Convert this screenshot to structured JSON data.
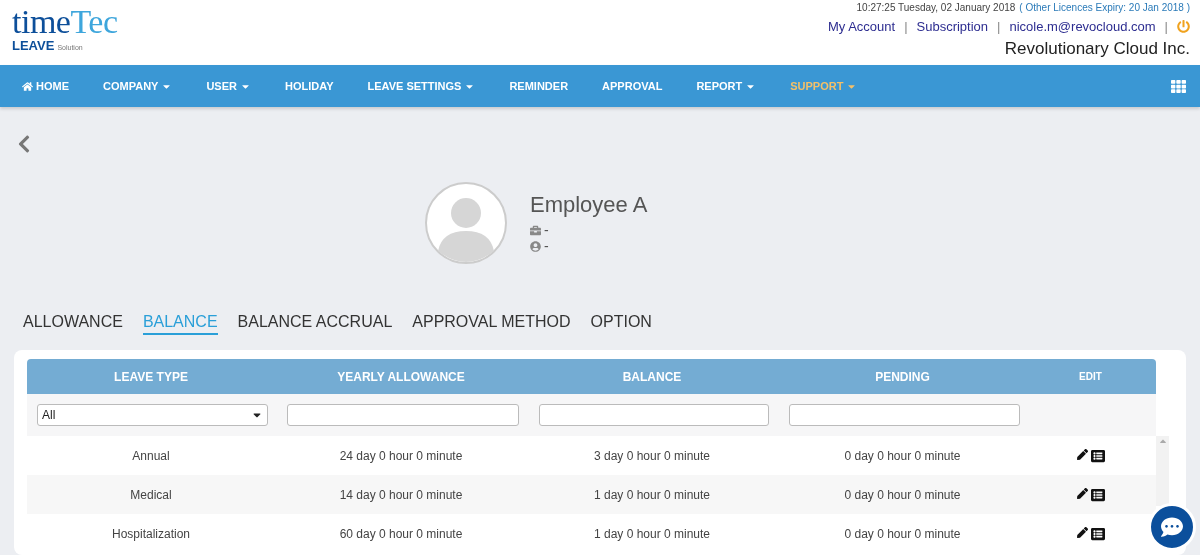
{
  "logo": {
    "word_dark": "time",
    "word_light": "Tec",
    "product": "LEAVE",
    "suffix": "Solution"
  },
  "header": {
    "datetime": "10:27:25 Tuesday, 02 January 2018",
    "licence_note": "( Other Licences Expiry:  20 Jan 2018  )",
    "links": [
      "My Account",
      "Subscription",
      "nicole.m@revocloud.com"
    ],
    "separators": [
      "|",
      "|",
      "|"
    ],
    "company": "Revolutionary Cloud Inc."
  },
  "nav": [
    {
      "label": "HOME",
      "kind": "home",
      "dropdown": false,
      "selected": false
    },
    {
      "label": "COMPANY",
      "kind": "plain",
      "dropdown": true,
      "selected": false
    },
    {
      "label": "USER",
      "kind": "plain",
      "dropdown": true,
      "selected": false
    },
    {
      "label": "HOLIDAY",
      "kind": "plain",
      "dropdown": false,
      "selected": false
    },
    {
      "label": "LEAVE SETTINGS",
      "kind": "plain",
      "dropdown": true,
      "selected": false
    },
    {
      "label": "REMINDER",
      "kind": "plain",
      "dropdown": false,
      "selected": false
    },
    {
      "label": "APPROVAL",
      "kind": "plain",
      "dropdown": false,
      "selected": false
    },
    {
      "label": "REPORT",
      "kind": "plain",
      "dropdown": true,
      "selected": false
    },
    {
      "label": "SUPPORT",
      "kind": "plain",
      "dropdown": true,
      "selected": true
    }
  ],
  "profile": {
    "name": "Employee A",
    "position": "-",
    "group": "-"
  },
  "tabs": [
    {
      "label": "ALLOWANCE",
      "selected": false
    },
    {
      "label": "BALANCE",
      "selected": true
    },
    {
      "label": "BALANCE ACCRUAL",
      "selected": false
    },
    {
      "label": "APPROVAL METHOD",
      "selected": false
    },
    {
      "label": "OPTION",
      "selected": false
    }
  ],
  "table": {
    "columns": [
      "LEAVE TYPE",
      "YEARLY ALLOWANCE",
      "BALANCE",
      "PENDING",
      "EDIT"
    ],
    "filters": {
      "leave_type": "All"
    },
    "rows": [
      {
        "leave_type": "Annual",
        "yearly_allowance": "24 day 0 hour 0 minute",
        "balance": "3 day 0 hour 0 minute",
        "pending": "0 day 0 hour 0 minute"
      },
      {
        "leave_type": "Medical",
        "yearly_allowance": "14 day 0 hour 0 minute",
        "balance": "1 day 0 hour 0 minute",
        "pending": "0 day 0 hour 0 minute"
      },
      {
        "leave_type": "Hospitalization",
        "yearly_allowance": "60 day 0 hour 0 minute",
        "balance": "1 day 0 hour 0 minute",
        "pending": "0 day 0 hour 0 minute"
      }
    ]
  }
}
